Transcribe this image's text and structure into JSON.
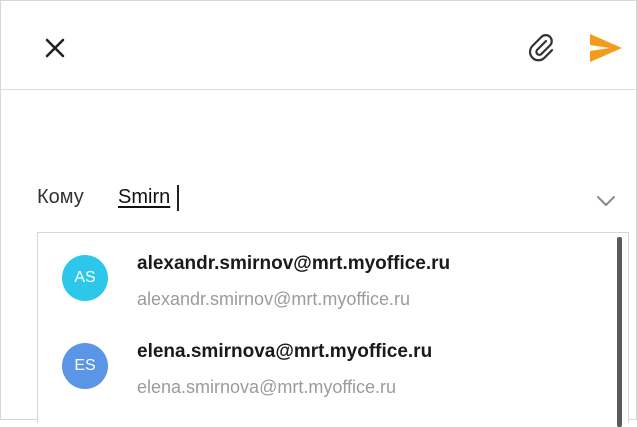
{
  "toolbar": {
    "close_icon": "close-icon",
    "attach_icon": "paperclip-icon",
    "send_icon": "send-icon",
    "send_color": "#f59a1b"
  },
  "recipient": {
    "label": "Кому",
    "value": "Smirn",
    "expand_icon": "chevron-down-icon"
  },
  "suggestions": [
    {
      "initials": "AS",
      "name": "alexandr.smirnov@mrt.myoffice.ru",
      "email": "alexandr.smirnov@mrt.myoffice.ru",
      "color": "#2dc7ea"
    },
    {
      "initials": "ES",
      "name": "elena.smirnova@mrt.myoffice.ru",
      "email": "elena.smirnova@mrt.myoffice.ru",
      "color": "#5a95e6"
    }
  ]
}
